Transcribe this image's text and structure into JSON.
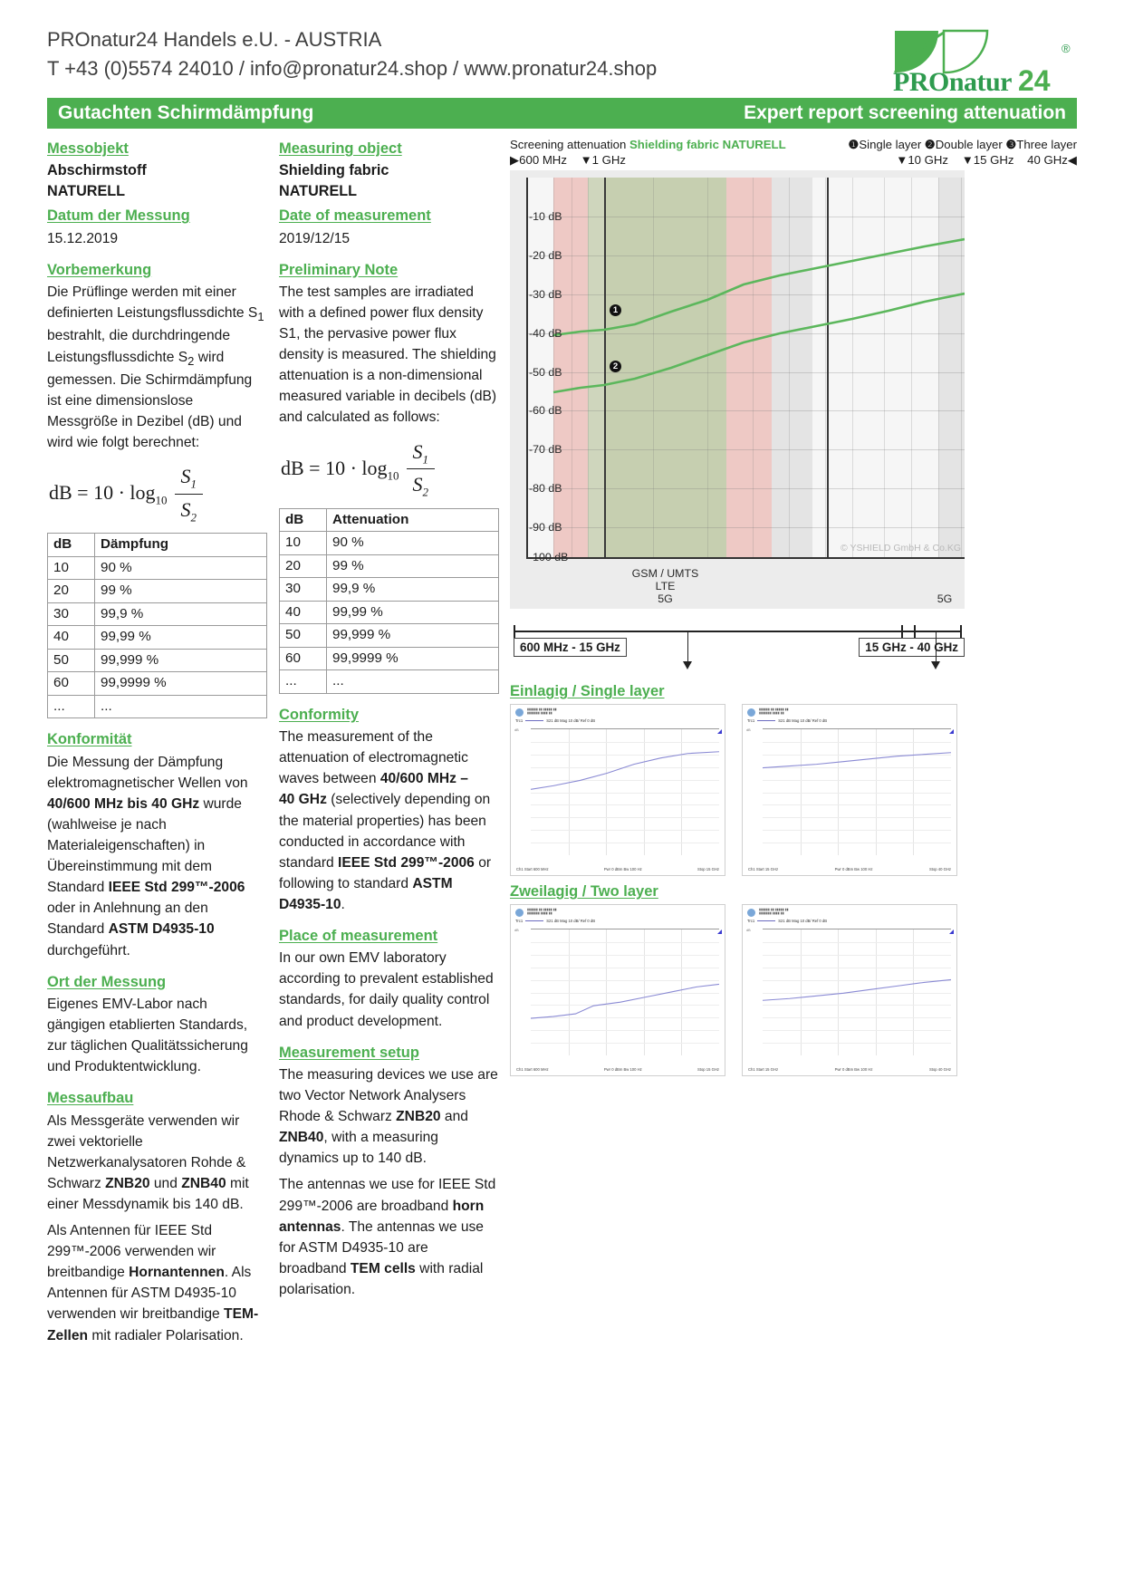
{
  "header": {
    "company_line1": "PROnatur24 Handels e.U. - AUSTRIA",
    "company_line2": "T +43 (0)5574 24010 / info@pronatur24.shop / www.pronatur24.shop",
    "logo_text": "PROnatur24",
    "logo_registered": "®"
  },
  "titlebar": {
    "left": "Gutachten Schirmdämpfung",
    "right": "Expert report screening attenuation",
    "color": "#4caf50"
  },
  "de": {
    "h_messobjekt": "Messobjekt",
    "messobjekt_1": "Abschirmstoff",
    "messobjekt_2": "NATURELL",
    "h_datum": "Datum der Messung",
    "datum": "15.12.2019",
    "h_vorbemerkung": "Vorbemerkung",
    "vorbemerkung": "Die Prüflinge werden mit einer definierten Leistungsflussdichte S1 bestrahlt, die durchdringende Leistungsflussdichte S2 wird gemessen. Die Schirmdämpfung ist eine dimensionslose Messgröße in Dezibel (dB) und wird wie folgt berechnet:",
    "table_head_db": "dB",
    "table_head_att": "Dämpfung",
    "table_rows": [
      [
        "10",
        "90 %"
      ],
      [
        "20",
        "99 %"
      ],
      [
        "30",
        "99,9 %"
      ],
      [
        "40",
        "99,99 %"
      ],
      [
        "50",
        "99,999 %"
      ],
      [
        "60",
        "99,9999 %"
      ],
      [
        "...",
        "..."
      ]
    ],
    "h_konformitaet": "Konformität",
    "konformitaet": "Die Messung der Dämpfung elektromagnetischer Wellen von 40/600 MHz bis 40 GHz wurde (wahlweise je nach Materialeigenschaften) in Übereinstimmung mit dem Standard IEEE Std 299™-2006 oder in Anlehnung an den Standard ASTM D4935-10 durchgeführt.",
    "h_ort": "Ort der Messung",
    "ort": "Eigenes EMV-Labor nach gängigen etablierten Standards, zur täglichen Qualitätssicherung und Produktentwicklung.",
    "h_messaufbau": "Messaufbau",
    "messaufbau_1": "Als Messgeräte verwenden wir zwei vektorielle Netzwerkanalysatoren Rohde & Schwarz ZNB20 und ZNB40 mit einer Messdynamik bis 140 dB.",
    "messaufbau_2": "Als Antennen für IEEE Std 299™-2006 verwenden wir breitbandige Hornantennen. Als Antennen für ASTM D4935-10 verwenden wir breitbandige TEM-Zellen mit radialer Polarisation."
  },
  "en": {
    "h_measuring_object": "Measuring object",
    "measuring_object_1": "Shielding fabric",
    "measuring_object_2": "NATURELL",
    "h_date": "Date of measurement",
    "date": "2019/12/15",
    "h_prelim": "Preliminary Note",
    "prelim": "The test samples are irradiated with a defined power flux density S1, the pervasive power flux density is measured. The shielding attenuation is a non-dimensional measured variable in decibels (dB) and calculated as follows:",
    "table_head_db": "dB",
    "table_head_att": "Attenuation",
    "table_rows": [
      [
        "10",
        "90 %"
      ],
      [
        "20",
        "99 %"
      ],
      [
        "30",
        "99,9 %"
      ],
      [
        "40",
        "99,99 %"
      ],
      [
        "50",
        "99,999 %"
      ],
      [
        "60",
        "99,9999 %"
      ],
      [
        "...",
        "..."
      ]
    ],
    "h_conformity": "Conformity",
    "conformity": "The measurement of the attenuation of electromagnetic waves between 40/600 MHz – 40 GHz (selectively depending on the material properties) has been conducted in accordance with standard IEEE Std 299™-2006 or following to standard ASTM D4935-10.",
    "h_place": "Place of measurement",
    "place": "In our own EMV laboratory according to prevalent established standards, for daily quality control and product development.",
    "h_setup": "Measurement setup",
    "setup_1": "The measuring devices we use are two Vector Network Analysers Rhode & Schwarz ZNB20 and ZNB40, with a measuring dynamics up to 140 dB.",
    "setup_2": "The antennas we use for IEEE Std 299™-2006 are broadband horn antennas. The antennas we use for ASTM D4935-10 are broadband TEM cells with radial polarisation."
  },
  "formula": {
    "lhs": "dB = 10 · log",
    "log_base": "10",
    "numerator": "S",
    "numerator_sub": "1",
    "denominator": "S",
    "denominator_sub": "2"
  },
  "chart_data": {
    "type": "line",
    "title": "Screening attenuation",
    "title_highlight": "Shielding fabric NATURELL",
    "legend": [
      {
        "symbol": "❶",
        "label": "Single layer"
      },
      {
        "symbol": "❷",
        "label": "Double layer"
      },
      {
        "symbol": "❸",
        "label": "Three layer"
      }
    ],
    "x_markers_left": [
      {
        "glyph": "▶",
        "label": "600 MHz"
      },
      {
        "glyph": "▼",
        "label": "1 GHz"
      }
    ],
    "x_markers_right": [
      {
        "glyph": "▼",
        "label": "10 GHz"
      },
      {
        "glyph": "▼",
        "label": "15 GHz"
      },
      {
        "glyph": "◀",
        "label": "40 GHz"
      }
    ],
    "ylabel": "dB",
    "ytick_labels": [
      "-10 dB",
      "-20 dB",
      "-30 dB",
      "-40 dB",
      "-50 dB",
      "-60 dB",
      "-70 dB",
      "-80 dB",
      "-90 dB",
      "-100 dB"
    ],
    "ylim": [
      -100,
      0
    ],
    "xlim_ghz": [
      0.04,
      40
    ],
    "grid": true,
    "series": [
      {
        "name": "Single layer",
        "marker": "❶",
        "points": [
          [
            0.6,
            -41.5
          ],
          [
            1.0,
            -40.0
          ],
          [
            2.0,
            -38.0
          ],
          [
            4.0,
            -34.0
          ],
          [
            7.0,
            -30.0
          ],
          [
            10.0,
            -26.0
          ],
          [
            15.0,
            -24.0
          ],
          [
            25.0,
            -21.0
          ],
          [
            40.0,
            -17.5
          ]
        ]
      },
      {
        "name": "Double layer",
        "marker": "❷",
        "points": [
          [
            0.6,
            -56.5
          ],
          [
            1.0,
            -54.5
          ],
          [
            2.0,
            -52.0
          ],
          [
            4.0,
            -48.0
          ],
          [
            7.0,
            -44.5
          ],
          [
            10.0,
            -41.0
          ],
          [
            15.0,
            -39.0
          ],
          [
            25.0,
            -35.0
          ],
          [
            40.0,
            -30.5
          ]
        ]
      }
    ],
    "bands": [
      {
        "label": "GSM / UMTS",
        "color": "#c8cfb4"
      },
      {
        "label": "LTE",
        "color": "#eec6c2"
      },
      {
        "label": "5G",
        "color": "#e2e2e2"
      },
      {
        "label": "5G",
        "color": "#e2e2e2"
      }
    ],
    "copyright": "© YSHIELD GmbH & Co.KG"
  },
  "range_bar": {
    "left_label": "600 MHz - 15 GHz",
    "right_label": "15 GHz - 40 GHz"
  },
  "minis": {
    "heading_single": "Einlagig / Single layer",
    "heading_double": "Zweilagig / Two layer",
    "panels": [
      {
        "trace": "Trc1",
        "trace_info": "S21  dB Mag 10 dB/ Ref 0 dB",
        "ydB": "dB",
        "start": "Ch1  Start 600 MHz",
        "pwr": "Pwr 0 dBm Bw 100 Hz",
        "stop": "Stop 15 GHz"
      },
      {
        "trace": "Trc1",
        "trace_info": "S21  dB Mag 10 dB/ Ref 0 dB",
        "ydB": "dB",
        "start": "Ch1  Start 15 GHz",
        "pwr": "Pwr 0 dBm Bw 100 Hz",
        "stop": "Stop 40 GHz"
      },
      {
        "trace": "Trc1",
        "trace_info": "S21  dB Mag 10 dB/ Ref 0 dB",
        "ydB": "dB",
        "start": "Ch1  Start 600 MHz",
        "pwr": "Pwr 0 dBm Bw 100 Hz",
        "stop": "Stop 15 GHz"
      },
      {
        "trace": "Trc1",
        "trace_info": "S21  dB Mag 10 dB/ Ref 0 dB",
        "ydB": "dB",
        "start": "Ch1  Start 15 GHz",
        "pwr": "Pwr 0 dBm Bw 100 Hz",
        "stop": "Stop 40 GHz"
      }
    ]
  }
}
